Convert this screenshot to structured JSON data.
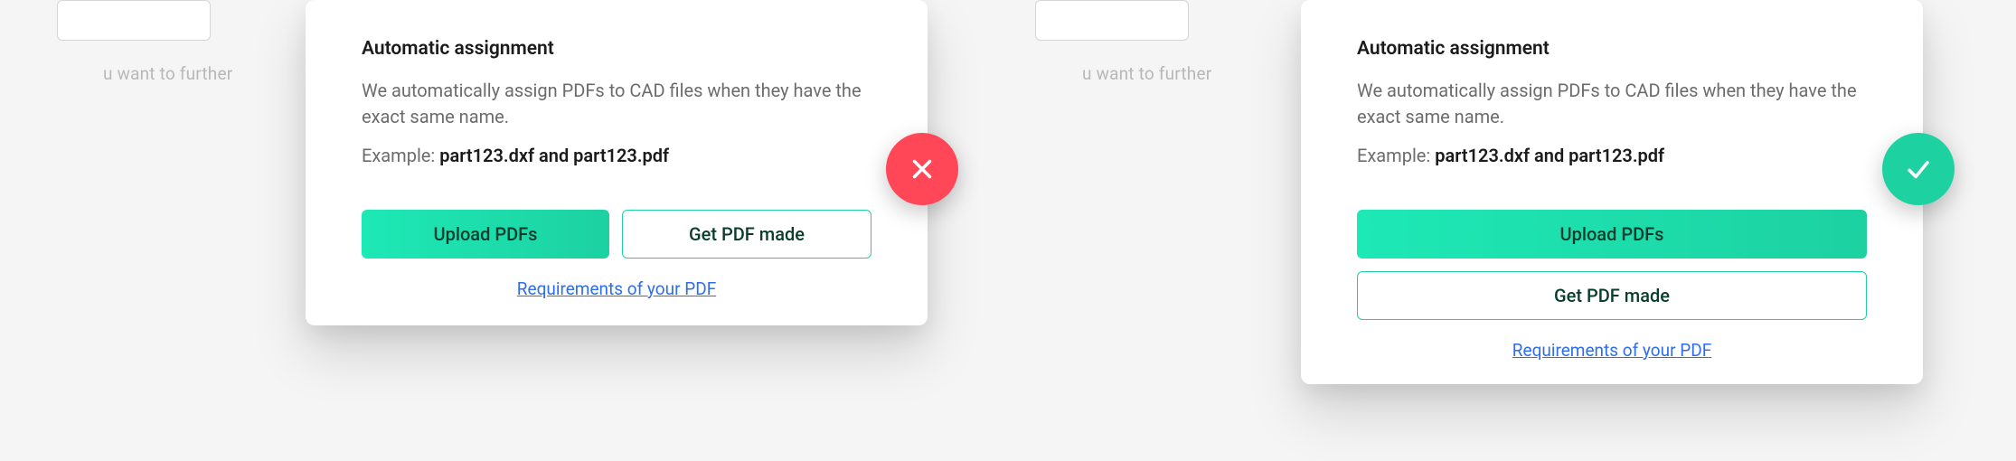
{
  "background": {
    "left_text": "u want to further",
    "right_text": "u want to further"
  },
  "card1": {
    "title": "Automatic assignment",
    "description": "We automatically assign PDFs to CAD files when they have the exact same name.",
    "example_prefix": "Example: ",
    "example_bold": "part123.dxf and part123.pdf",
    "upload_label": "Upload PDFs",
    "get_pdf_label": "Get PDF made",
    "requirements_link": "Requirements of your PDF"
  },
  "card2": {
    "title": "Automatic assignment",
    "description": "We automatically assign PDFs to CAD files when they have the exact same name.",
    "example_prefix": "Example: ",
    "example_bold": "part123.dxf and part123.pdf",
    "upload_label": "Upload PDFs",
    "get_pdf_label": "Get PDF made",
    "requirements_link": "Requirements of your PDF"
  }
}
